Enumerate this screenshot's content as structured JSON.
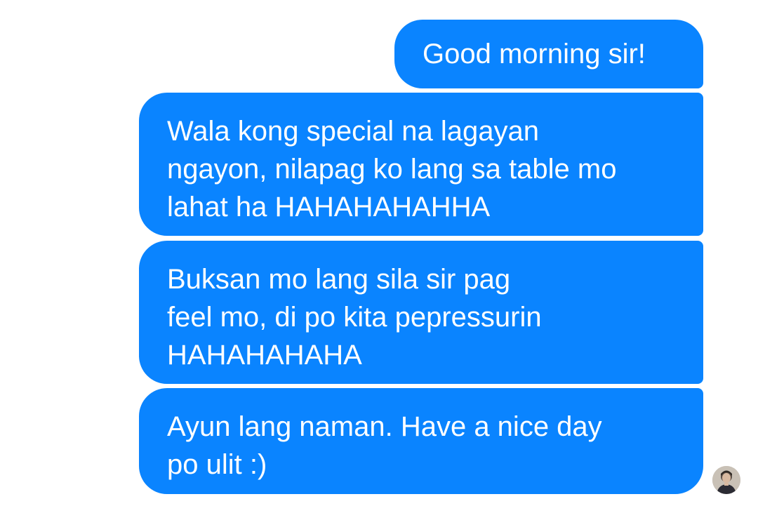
{
  "conversation": {
    "messages": [
      {
        "lines": [
          "Good morning sir!"
        ]
      },
      {
        "lines": [
          "Wala kong special na lagayan",
          "ngayon, nilapag ko lang sa table mo",
          "lahat ha HAHAHAHAHHA"
        ]
      },
      {
        "lines": [
          "Buksan mo lang sila sir pag",
          "feel mo, di po kita pepressurin",
          "HAHAHAHAHA"
        ]
      },
      {
        "lines": [
          "Ayun lang naman. Have a nice day",
          "po ulit :)"
        ]
      }
    ]
  },
  "colors": {
    "bubble": "#0a84ff",
    "bubble_text": "#ffffff",
    "background": "#ffffff"
  },
  "icons": {
    "sender_avatar": "user-avatar-photo"
  }
}
